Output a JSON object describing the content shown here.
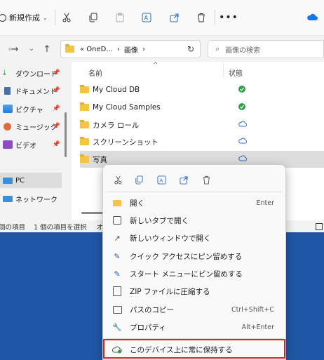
{
  "toolbar": {
    "new_label": "新規作成"
  },
  "address": {
    "segments": [
      "« OneD...",
      "›",
      "画像",
      "›"
    ],
    "search_placeholder": "画像の検索"
  },
  "sidebar": {
    "items": [
      {
        "label": "ダウンロード",
        "icon": "download-icon",
        "pinned": true
      },
      {
        "label": "ドキュメント",
        "icon": "document-icon",
        "pinned": true
      },
      {
        "label": "ピクチャ",
        "icon": "picture-icon",
        "pinned": true
      },
      {
        "label": "ミュージック",
        "icon": "music-icon",
        "pinned": true
      },
      {
        "label": "ビデオ",
        "icon": "video-icon",
        "pinned": true
      },
      {
        "label": "PC",
        "icon": "pc-icon",
        "pinned": false
      },
      {
        "label": "ネットワーク",
        "icon": "network-icon",
        "pinned": false
      }
    ]
  },
  "columns": {
    "name": "名前",
    "status": "状態"
  },
  "files": [
    {
      "name": "My Cloud DB",
      "status": "synced"
    },
    {
      "name": "My Cloud Samples",
      "status": "synced"
    },
    {
      "name": "カメラ ロール",
      "status": "cloud"
    },
    {
      "name": "スクリーンショット",
      "status": "cloud"
    },
    {
      "name": "写真",
      "status": "cloud",
      "selected": true
    }
  ],
  "statusbar": {
    "count": "個の項目",
    "selection": "1 個の項目を選択",
    "extra": "オン"
  },
  "context_menu": {
    "items": [
      {
        "label": "開く",
        "accel": "Enter",
        "icon": "open-folder-icon"
      },
      {
        "label": "新しいタブで開く",
        "accel": "",
        "icon": "new-tab-icon"
      },
      {
        "label": "新しいウィンドウで開く",
        "accel": "",
        "icon": "new-window-icon"
      },
      {
        "label": "クイック アクセスにピン留めする",
        "accel": "",
        "icon": "pin-icon"
      },
      {
        "label": "スタート メニューにピン留めする",
        "accel": "",
        "icon": "pin-start-icon"
      },
      {
        "label": "ZIP ファイルに圧縮する",
        "accel": "",
        "icon": "zip-icon"
      },
      {
        "label": "パスのコピー",
        "accel": "Ctrl+Shift+C",
        "icon": "copy-path-icon"
      },
      {
        "label": "プロパティ",
        "accel": "Alt+Enter",
        "icon": "properties-icon"
      },
      {
        "label": "このデバイス上に常に保持する",
        "accel": "",
        "icon": "keep-on-device-icon"
      }
    ]
  },
  "colors": {
    "accent": "#1f57a6",
    "highlight": "#d02828",
    "synced": "#2ea043",
    "cloud": "#2b6cc4"
  }
}
